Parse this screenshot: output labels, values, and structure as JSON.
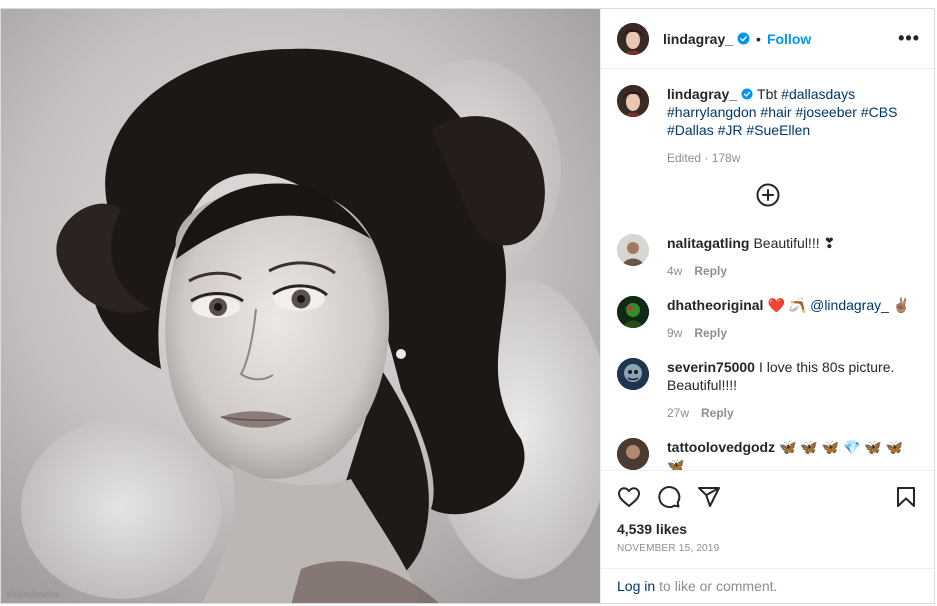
{
  "header": {
    "username": "lindagray_",
    "separator": "•",
    "follow_label": "Follow",
    "more_label": "•••"
  },
  "caption": {
    "username": "lindagray_",
    "text_plain": "Tbt",
    "tags": [
      "#dallasdays",
      "#harrylangdon",
      "#hair",
      "#joseeber",
      "#CBS",
      "#Dallas",
      "#JR",
      "#SueEllen"
    ],
    "meta": "Edited · 178w"
  },
  "comments": [
    {
      "username": "nalitagatling",
      "text": "Beautiful!!! ❣",
      "age": "4w",
      "reply": "Reply"
    },
    {
      "username": "dhatheoriginal",
      "text_pre": "❤️ 🪃 ",
      "mention": "@lindagray_",
      "text_post": " ✌🏽",
      "age": "9w",
      "reply": "Reply"
    },
    {
      "username": "severin75000",
      "text": "I love this 80s picture. Beautiful!!!!",
      "age": "27w",
      "reply": "Reply"
    },
    {
      "username": "tattoolovedgodz",
      "text": "🦋 🦋 🦋 💎 🦋 🦋 🦋"
    }
  ],
  "actions": {
    "likes": "4,539 likes",
    "date": "NOVEMBER 15, 2019"
  },
  "login_bar": {
    "link": "Log in",
    "text": "to like or comment."
  },
  "media": {
    "watermark": "dallasfanzine"
  },
  "colors": {
    "link_blue": "#0095f6",
    "tag_blue": "#00376b",
    "muted": "#8e8e8e",
    "text": "#262626"
  }
}
